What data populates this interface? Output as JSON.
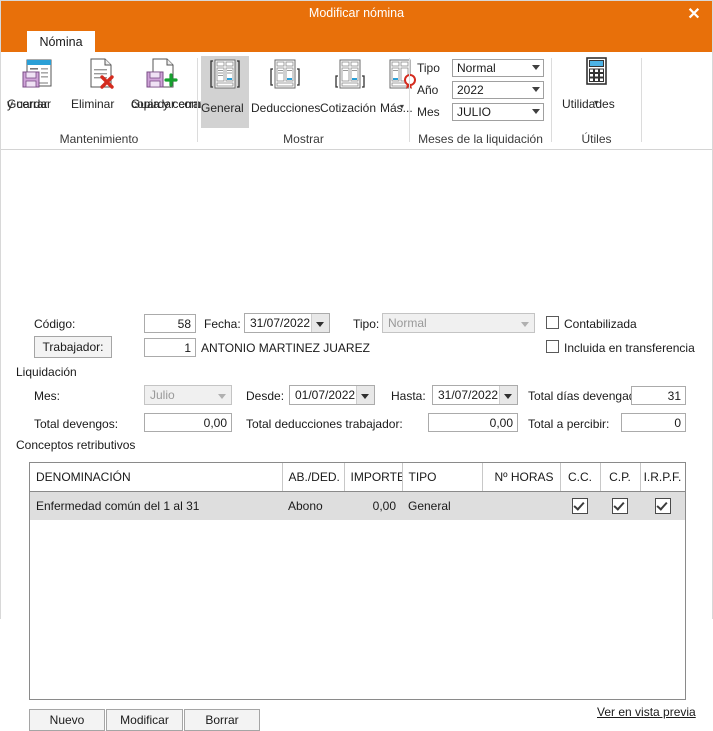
{
  "window": {
    "title": "Modificar nómina",
    "close_icon": "close-icon",
    "close_glyph": "✕"
  },
  "tabs": [
    {
      "label": "Nómina",
      "active": true
    }
  ],
  "ribbon": {
    "groups": [
      {
        "name": "mantenimiento",
        "label": "Mantenimiento",
        "buttons": [
          {
            "label": "Guardar\ny cerrar",
            "line1": "Guardar",
            "line2": "y cerrar",
            "icon": "save-and-close-icon"
          },
          {
            "label": "Eliminar",
            "line1": "Eliminar",
            "line2": "",
            "icon": "delete-icon"
          },
          {
            "label": "Guardar como copia y cerrar",
            "line1": "Guardar como",
            "line2": "copia y cerrar",
            "icon": "save-as-copy-icon",
            "has_dropdown": true
          }
        ]
      },
      {
        "name": "mostrar",
        "label": "Mostrar",
        "buttons": [
          {
            "label": "General",
            "icon": "document-general-icon",
            "selected": true
          },
          {
            "label": "Deducciones",
            "icon": "document-deductions-icon",
            "selected": false
          },
          {
            "label": "Cotización",
            "icon": "document-contribution-icon",
            "selected": false
          },
          {
            "label": "Más...",
            "icon": "document-seal-icon",
            "selected": false,
            "has_dropdown": true
          }
        ]
      },
      {
        "name": "meses-liquidacion",
        "label": "Meses de la liquidación",
        "combos": [
          {
            "label": "Tipo",
            "value": "Normal"
          },
          {
            "label": "Año",
            "value": "2022"
          },
          {
            "label": "Mes",
            "value": "JULIO"
          }
        ]
      },
      {
        "name": "utiles",
        "label": "Útiles",
        "buttons": [
          {
            "label": "Utilidades",
            "icon": "calculator-icon",
            "has_dropdown": true
          }
        ]
      }
    ]
  },
  "form": {
    "codigo_label": "Código:",
    "codigo_value": "58",
    "fecha_label": "Fecha:",
    "fecha_value": "31/07/2022",
    "tipo_label": "Tipo:",
    "tipo_value": "Normal",
    "trabajador_button": "Trabajador:",
    "trabajador_code": "1",
    "trabajador_name": "ANTONIO MARTINEZ JUAREZ",
    "contabilizada_label": "Contabilizada",
    "incluida_label": "Incluida en transferencia",
    "liquidacion_label": "Liquidación",
    "mes_label": "Mes:",
    "mes_value": "Julio",
    "desde_label": "Desde:",
    "desde_value": "01/07/2022",
    "hasta_label": "Hasta:",
    "hasta_value": "31/07/2022",
    "total_dias_label": "Total días devengados:",
    "total_dias_value": "31",
    "total_devengos_label": "Total devengos:",
    "total_devengos_value": "0,00",
    "total_deducciones_label": "Total deducciones trabajador:",
    "total_deducciones_value": "0,00",
    "total_percibir_label": "Total a percibir:",
    "total_percibir_value": "0",
    "conceptos_label": "Conceptos retributivos"
  },
  "grid": {
    "columns": [
      "DENOMINACIÓN",
      "AB./DED.",
      "IMPORTE",
      "TIPO",
      "Nº HORAS",
      "C.C.",
      "C.P.",
      "I.R.P.F."
    ],
    "rows": [
      {
        "denominacion": "Enfermedad común del 1 al 31",
        "abded": "Abono",
        "importe": "0,00",
        "tipo": "General",
        "horas": "",
        "cc": true,
        "cp": true,
        "irpf": true,
        "selected": true
      }
    ]
  },
  "footer": {
    "buttons": [
      {
        "label": "Nuevo",
        "name": "nuevo-button"
      },
      {
        "label": "Modificar",
        "name": "modificar-button"
      },
      {
        "label": "Borrar",
        "name": "borrar-button"
      }
    ],
    "preview_link": "Ver en vista previa"
  },
  "colors": {
    "accent": "#E8700A",
    "selected_row": "#dedede",
    "ribbon_selected": "#d2d2d2"
  }
}
